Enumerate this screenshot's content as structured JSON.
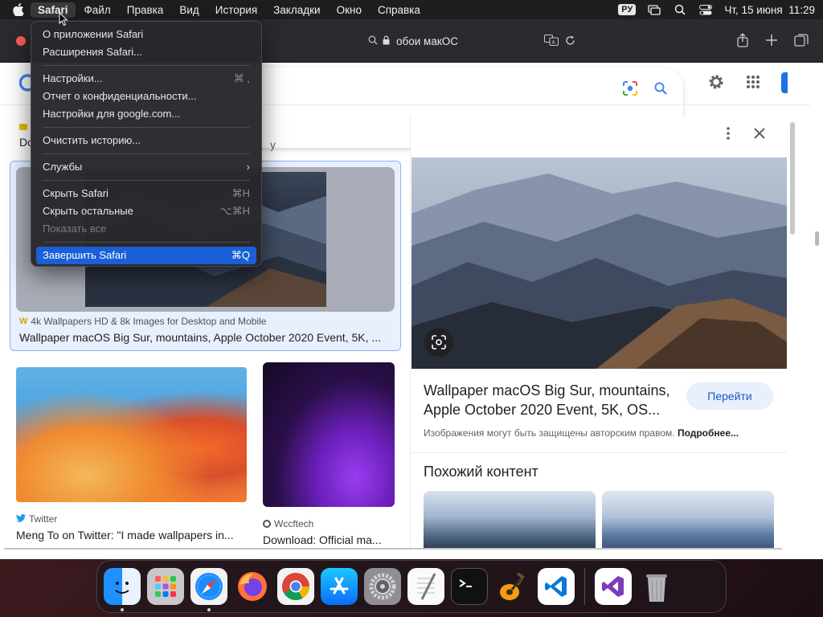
{
  "menubar": {
    "items": [
      "Safari",
      "Файл",
      "Правка",
      "Вид",
      "История",
      "Закладки",
      "Окно",
      "Справка"
    ],
    "lang": "РУ",
    "datetime": "Чт, 15 июня  11:29"
  },
  "address": {
    "text": "обои макОС"
  },
  "safari_menu": {
    "about": "О приложении Safari",
    "extensions": "Расширения Safari...",
    "settings": "Настройки...",
    "settings_shortcut": "⌘ ,",
    "privacy_report": "Отчет о конфиденциальности...",
    "site_settings": "Настройки для google.com...",
    "clear_history": "Очистить историю...",
    "services": "Службы",
    "hide_safari": "Скрыть Safari",
    "hide_safari_shortcut": "⌘H",
    "hide_others": "Скрыть остальные",
    "hide_others_shortcut": "⌥⌘H",
    "show_all": "Показать все",
    "quit": "Завершить Safari",
    "quit_shortcut": "⌘Q"
  },
  "results": {
    "snippet_left": "Do",
    "snippet_right": "y",
    "selected": {
      "source": "4k Wallpapers HD & 8k Images for Desktop and Mobile",
      "title": "Wallpaper macOS Big Sur, mountains, Apple October 2020 Event, 5K, ..."
    },
    "card1": {
      "source": "Twitter",
      "title": "Meng To on Twitter: \"I made wallpapers in..."
    },
    "card2": {
      "source": "Wccftech",
      "title": "Download: Official ma..."
    }
  },
  "panel": {
    "title": "Wallpaper macOS Big Sur, mountains, Apple October 2020 Event, 5K, OS...",
    "go_button": "Перейти",
    "copyright": "Изображения могут быть защищены авторским правом.",
    "more_link": "Подробнее...",
    "similar_heading": "Похожий контент"
  },
  "dock": {
    "apps": [
      "finder",
      "launchpad",
      "safari",
      "firefox",
      "chrome",
      "app-store",
      "system-settings",
      "textedit",
      "terminal",
      "garageband",
      "vscode",
      "visual-studio",
      "trash"
    ]
  }
}
